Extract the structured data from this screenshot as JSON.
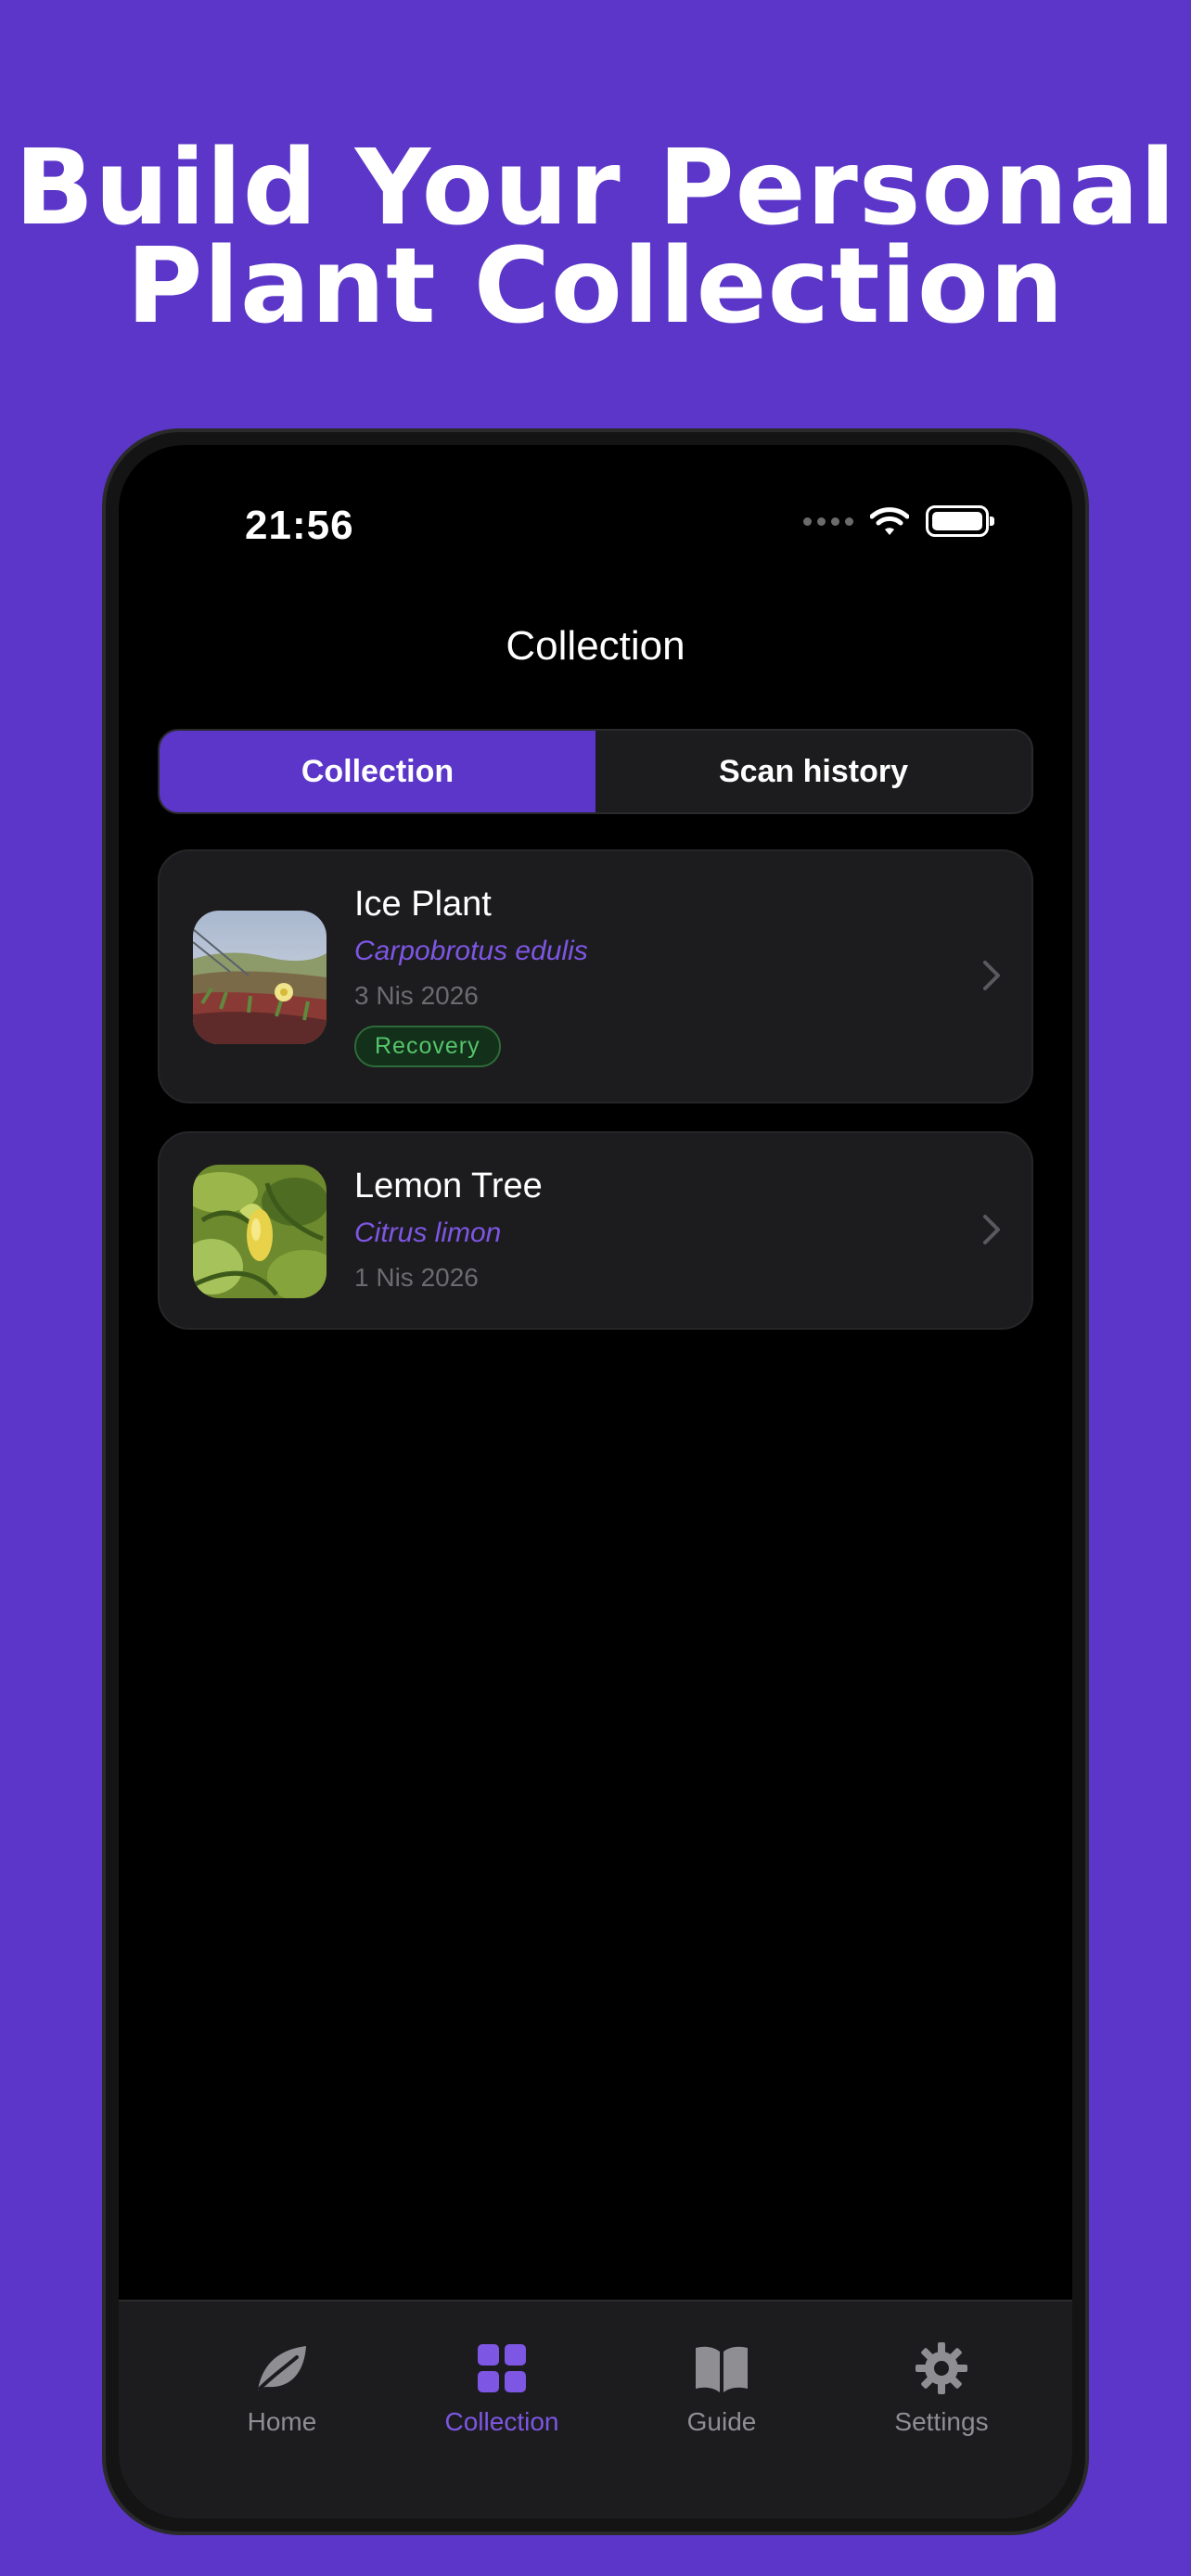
{
  "headline": {
    "line1": "Build Your Personal",
    "line2": "Plant Collection"
  },
  "status_bar": {
    "time": "21:56",
    "icons": [
      "signal-dots-icon",
      "wifi-icon",
      "battery-icon"
    ]
  },
  "nav": {
    "title": "Collection"
  },
  "segments": [
    {
      "label": "Collection",
      "active": true
    },
    {
      "label": "Scan history",
      "active": false
    }
  ],
  "plants": [
    {
      "name": "Ice Plant",
      "scientific_name": "Carpobrotus edulis",
      "date": "3 Nis 2026",
      "badge": "Recovery"
    },
    {
      "name": "Lemon Tree",
      "scientific_name": "Citrus limon",
      "date": "1 Nis 2026"
    }
  ],
  "tab_bar": {
    "items": [
      {
        "label": "Home",
        "icon": "leaf-icon",
        "active": false
      },
      {
        "label": "Collection",
        "icon": "grid-icon",
        "active": true
      },
      {
        "label": "Guide",
        "icon": "book-icon",
        "active": false
      },
      {
        "label": "Settings",
        "icon": "gear-icon",
        "active": false
      }
    ]
  },
  "colors": {
    "background": "#5b36c8",
    "accent": "#7e56e4",
    "card": "#1c1c1e",
    "badge_text": "#55c56a"
  }
}
